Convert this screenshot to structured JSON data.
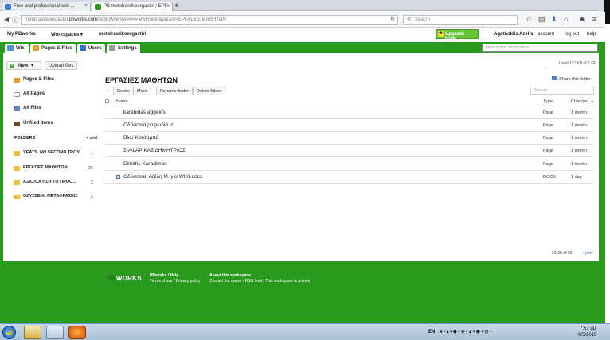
{
  "browser": {
    "tabs": [
      {
        "label": "Free and professional wiki ...",
        "active": false
      },
      {
        "label": "PB metafrastikoergastiri / ΕΡΓ...",
        "active": true
      }
    ],
    "new_tab": "+",
    "url_prefix": "metafrastikoergastiri.",
    "url_domain": "pbworks.com",
    "url_rest": "/w/browse/#view=ViewFolder&param=ΕΡΓΑΣΙΕΣ ΜΑΘΗΤΩΝ",
    "search_placeholder": "Search"
  },
  "pbworks_header": {
    "my_pbworks": "My PBworks",
    "workspaces": "Workspaces ▾",
    "workspace_name": "metafrastikoergastiri",
    "upgrade": "Upgrade Now!",
    "user": "Agathoklis Azelis",
    "account": "account",
    "logout": "log out",
    "help": "help"
  },
  "workspace_tabs": [
    {
      "label": "Wiki",
      "color": "#4a90d9"
    },
    {
      "label": "Pages & Files",
      "color": "#e0a030"
    },
    {
      "label": "Users",
      "color": "#3a6fc0"
    },
    {
      "label": "Settings",
      "color": "#999999"
    }
  ],
  "workspace_search_placeholder": "Search this workspace",
  "usage": "Used 117 KB of 2 GB",
  "share_folder": "Share this folder",
  "sidebar": {
    "new_label": "New",
    "upload_label": "Upload files",
    "items": [
      {
        "label": "Pages & Files"
      },
      {
        "label": "All Pages"
      },
      {
        "label": "All Files"
      },
      {
        "label": "Unfiled items"
      }
    ],
    "folders_heading": "FOLDERS",
    "add_label": "add",
    "folders": [
      {
        "label": "YEATS, NO SECOND TROY",
        "count": "1"
      },
      {
        "label": "ΕΡΓΑΣΙΕΣ ΜΑΘΗΤΩΝ",
        "count": "26"
      },
      {
        "label": "ΑΞΙΟΛΟΓΗΣΗ ΤΟ ΠΡΟΟ...",
        "count": "2"
      },
      {
        "label": "ΟΔΥΣΣΕΙΑ, ΜΕΤΑΦΡΑΣΕΙΣ",
        "count": "2"
      }
    ]
  },
  "main": {
    "title": "ΕΡΓΑΣΙΕΣ ΜΑΘΗΤΩΝ",
    "actions": [
      "Delete",
      "Move",
      "Rename folder",
      "Delete folder"
    ],
    "search_placeholder": "Search",
    "columns": {
      "name": "Name",
      "type": "Type",
      "changed": "Changed ▲"
    },
    "rows": [
      {
        "name": "karabidas aggelos",
        "type": "Page",
        "changed": "1 month",
        "checked": false
      },
      {
        "name": "Οδύσσεια ραψωδία α'",
        "type": "Page",
        "changed": "1 month",
        "checked": false
      },
      {
        "name": "Βίκυ Κατσαμπά",
        "type": "Page",
        "changed": "1 month",
        "checked": false
      },
      {
        "name": "ΣΙΑΦΑΡΙΚΑΣ ΔΗΜΗΤΡΙΟΣ",
        "type": "Page",
        "changed": "1 month",
        "checked": false
      },
      {
        "name": "Dimitris Karadimas",
        "type": "Page",
        "changed": "1 month",
        "checked": false
      },
      {
        "name": "Οδύσσεια, Αζέλη Μ. για WIKI.docx",
        "type": "DOCX",
        "changed": "1 day",
        "checked": true
      }
    ],
    "pagination": "21-26 of 26",
    "prev": "‹ prev"
  },
  "footer": {
    "logo_a": "PB",
    "logo_b": "WORKS",
    "pbworks_help": "PBworks / Help",
    "terms": "Terms of use / Privacy policy",
    "about_heading": "About this workspace",
    "about_text": "Contact the owner / RSS feed / This workspace is private"
  },
  "taskbar": {
    "lang": "EN",
    "time": "7:57 μμ",
    "date": "6/5/2015"
  }
}
